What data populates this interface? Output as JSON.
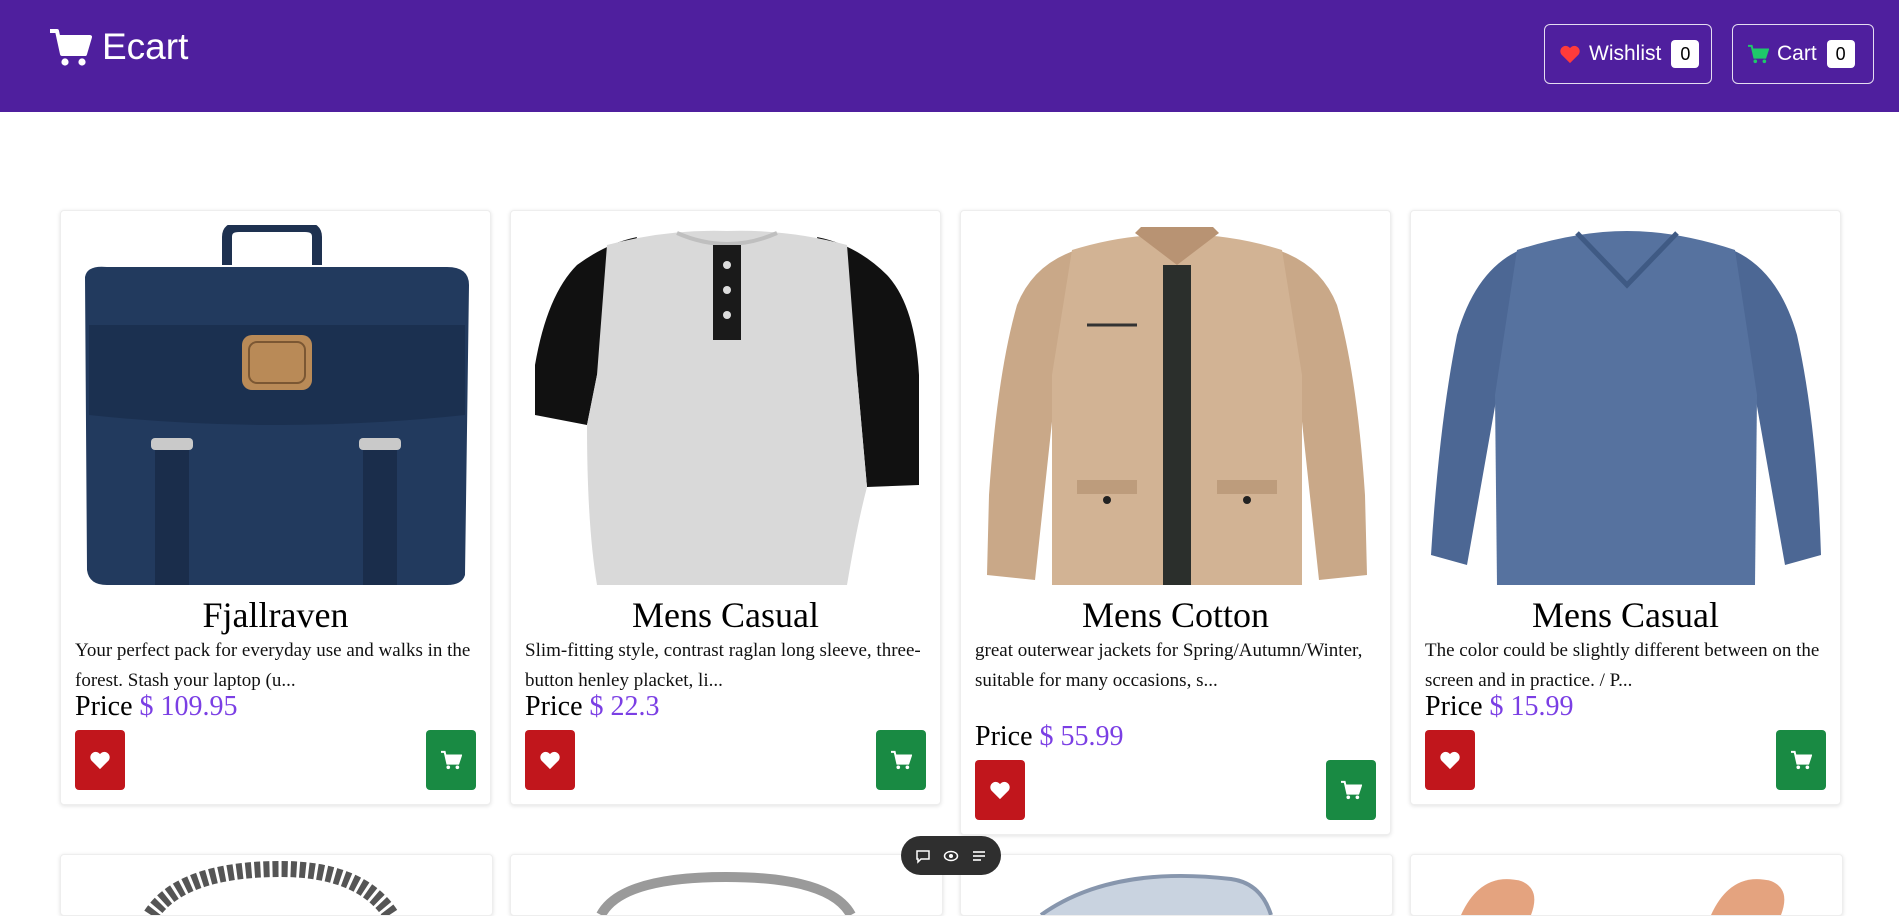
{
  "header": {
    "brand": "Ecart",
    "wishlist": {
      "label": "Wishlist",
      "count": "0"
    },
    "cart": {
      "label": "Cart",
      "count": "0"
    }
  },
  "products": [
    {
      "title": "Fjallraven",
      "description": "Your perfect pack for everyday use and walks in the forest. Stash your laptop (u...",
      "price_label": "Price",
      "price": "$ 109.95"
    },
    {
      "title": "Mens Casual",
      "description": "Slim-fitting style, contrast raglan long sleeve, three-button henley placket, li...",
      "price_label": "Price",
      "price": "$ 22.3"
    },
    {
      "title": "Mens Cotton",
      "description": "great outerwear jackets for Spring/Autumn/Winter, suitable for many occasions, s...",
      "price_label": "Price",
      "price": "$ 55.99"
    },
    {
      "title": "Mens Casual",
      "description": "The color could be slightly different between on the screen and in practice. / P...",
      "price_label": "Price",
      "price": "$ 15.99"
    }
  ],
  "icons": {
    "brand": "shopping-cart-icon",
    "wishlist": "heart-icon",
    "cart": "shopping-cart-icon",
    "product_heart": "heart-icon",
    "product_cart": "shopping-cart-icon",
    "floatbar": [
      "comment-icon",
      "eye-icon",
      "menu-icon"
    ]
  },
  "colors": {
    "navbar": "#4f1f9e",
    "heart_button": "#c1161c",
    "cart_button": "#198a43",
    "price": "#7b3fe4",
    "wishlist_heart": "#ff3b3b",
    "cart_icon": "#1ec86a"
  }
}
